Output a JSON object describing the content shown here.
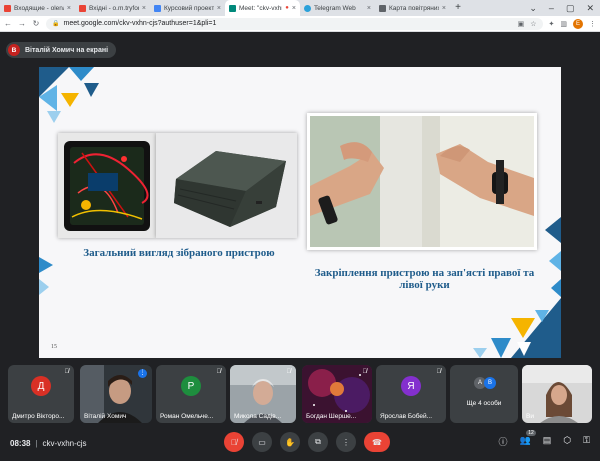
{
  "browser": {
    "tabs": [
      {
        "title": "Входящие - olena.",
        "color": "#ea4335"
      },
      {
        "title": "Вхідні - o.m.tryfon",
        "color": "#ea4335"
      },
      {
        "title": "Курсовий проект",
        "color": "#4285f4"
      },
      {
        "title": "Meet: \"ckv-vxhn",
        "color": "#00897b"
      },
      {
        "title": "Telegram Web",
        "color": "#2aa1da"
      },
      {
        "title": "Карта повітряних т",
        "color": "#5f6368"
      }
    ],
    "new_tab": "+",
    "url": "meet.google.com/ckv-vxhn-cjs?authuser=1&pli=1",
    "profile_letter": "E"
  },
  "presenter": {
    "avatar_letter": "В",
    "label": "Віталій Хомич на екрані"
  },
  "slide": {
    "number": "15",
    "left_caption": "Загальний вигляд зібраного пристрою",
    "right_caption": "Закріплення пристрою на зап'ясті правої та лівої руки"
  },
  "participants": [
    {
      "name": "Дмитро Вікторо...",
      "letter": "Д",
      "color": "#d93025",
      "type": "avatar"
    },
    {
      "name": "Віталій Хомич",
      "letter": "",
      "color": "",
      "type": "video"
    },
    {
      "name": "Роман Омельче...",
      "letter": "Р",
      "color": "#1e8e3e",
      "type": "avatar"
    },
    {
      "name": "Микола Садів...",
      "letter": "",
      "color": "",
      "type": "video"
    },
    {
      "name": "Богдан Шерше...",
      "letter": "",
      "color": "",
      "type": "video"
    },
    {
      "name": "Ярослав Бобей...",
      "letter": "Я",
      "color": "#8430ce",
      "type": "avatar"
    },
    {
      "name": "Ще 4 особи",
      "letter": "",
      "color": "",
      "type": "more"
    },
    {
      "name": "Ви",
      "letter": "",
      "color": "",
      "type": "video"
    }
  ],
  "more_avatars": [
    "А",
    "В"
  ],
  "meeting": {
    "time": "08:38",
    "separator": "|",
    "code": "ckv-vxhn-cjs",
    "participant_count": "12"
  }
}
